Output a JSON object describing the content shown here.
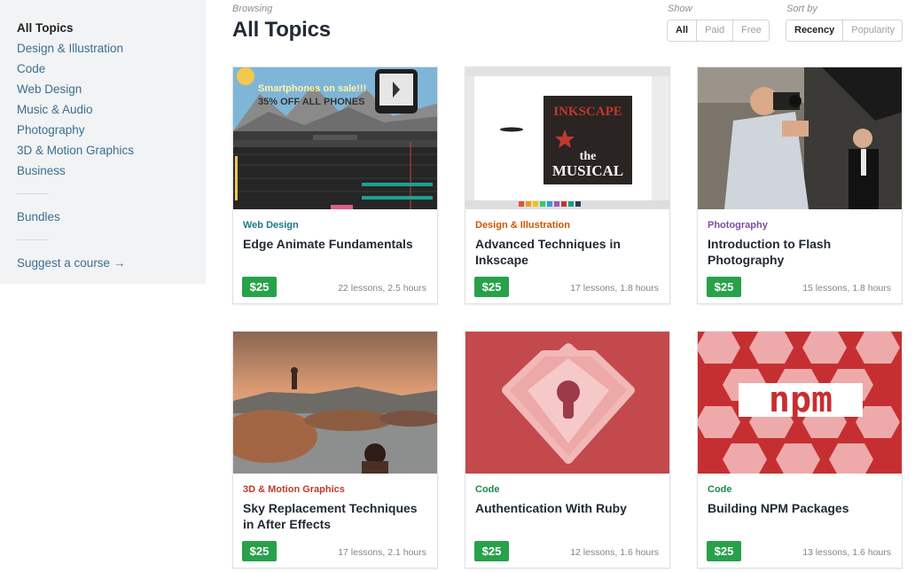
{
  "sidebar": {
    "items": [
      {
        "label": "All Topics",
        "active": true
      },
      {
        "label": "Design & Illustration"
      },
      {
        "label": "Code"
      },
      {
        "label": "Web Design"
      },
      {
        "label": "Music & Audio"
      },
      {
        "label": "Photography"
      },
      {
        "label": "3D & Motion Graphics"
      },
      {
        "label": "Business"
      }
    ],
    "bundles": "Bundles",
    "suggest": "Suggest a course →"
  },
  "header": {
    "browsing": "Browsing",
    "title": "All Topics",
    "show_label": "Show",
    "show_options": [
      "All",
      "Paid",
      "Free"
    ],
    "sort_label": "Sort by",
    "sort_options": [
      "Recency",
      "Popularity"
    ]
  },
  "colors": {
    "Web Design": "#1d7a86",
    "Design & Illustration": "#d35400",
    "Photography": "#7b4ea3",
    "3D & Motion Graphics": "#c0392b",
    "Code": "#1f8a4c",
    "price": "#27a24a"
  },
  "courses": [
    {
      "category": "Web Design",
      "title": "Edge Animate Fundamentals",
      "price": "$25",
      "meta": "22 lessons, 2.5 hours",
      "thumb": "edge-animate",
      "thumb_text_1": "Smartphones on sale!!!",
      "thumb_text_2": "35% OFF ALL PHONES"
    },
    {
      "category": "Design & Illustration",
      "title": "Advanced Techniques in Inkscape",
      "price": "$25",
      "meta": "17 lessons, 1.8 hours",
      "thumb": "inkscape",
      "thumb_text_1": "INKSCAPE",
      "thumb_text_2": "the",
      "thumb_text_3": "MUSICAL"
    },
    {
      "category": "Photography",
      "title": "Introduction to Flash Photography",
      "price": "$25",
      "meta": "15 lessons, 1.8 hours",
      "thumb": "photographer"
    },
    {
      "category": "3D & Motion Graphics",
      "title": "Sky Replacement Techniques in After Effects",
      "price": "$25",
      "meta": "17 lessons, 2.1 hours",
      "thumb": "sky-rocks"
    },
    {
      "category": "Code",
      "title": "Authentication With Ruby",
      "price": "$25",
      "meta": "12 lessons, 1.6 hours",
      "thumb": "ruby-lock"
    },
    {
      "category": "Code",
      "title": "Building NPM Packages",
      "price": "$25",
      "meta": "13 lessons, 1.6 hours",
      "thumb": "npm-logo",
      "thumb_text_1": "npm"
    }
  ]
}
